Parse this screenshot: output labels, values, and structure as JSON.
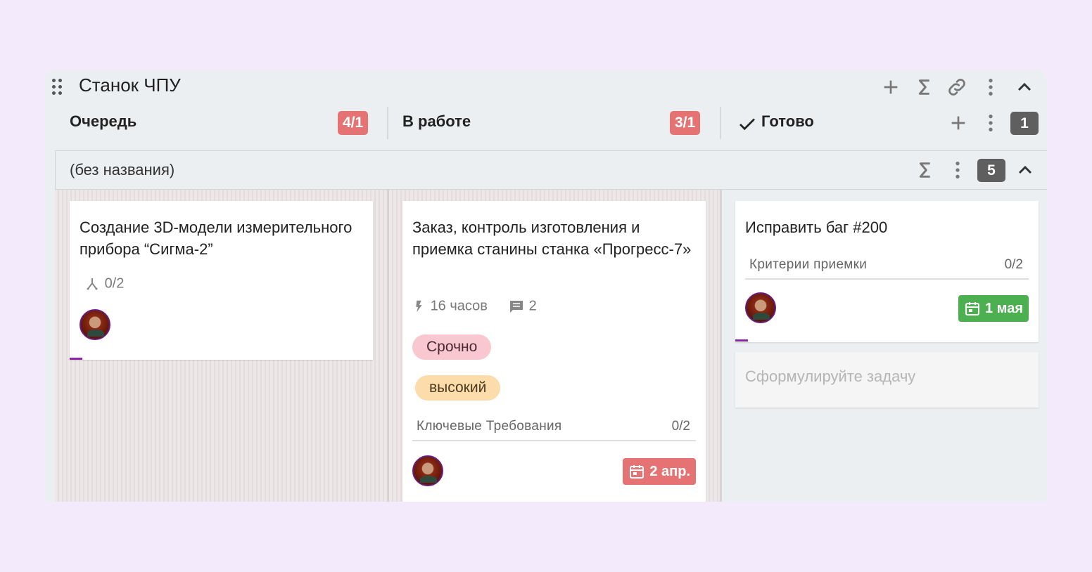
{
  "board": {
    "title": "Станок ЧПУ"
  },
  "columns": [
    {
      "label": "Очередь",
      "wip": "4/1"
    },
    {
      "label": "В работе",
      "wip": "3/1"
    },
    {
      "label": "Готово",
      "count": "1"
    }
  ],
  "swimlane": {
    "title": "(без названия)",
    "count": "5"
  },
  "cards": {
    "queue": {
      "title": "Создание 3D-модели измерительного прибора “Сигма-2”",
      "subtasks": "0/2"
    },
    "in_progress": {
      "title": "Заказ, контроль изготовления и приемка станины станка «Прогресс-7»",
      "estimate": "16 часов",
      "comments": "2",
      "tags": [
        "Срочно",
        "высокий"
      ],
      "checklist_label": "Ключевые Требования",
      "checklist_count": "0/2",
      "due": "2 апр."
    },
    "done": {
      "title": "Исправить баг #200",
      "checklist_label": "Критерии приемки",
      "checklist_count": "0/2",
      "due": "1 мая"
    }
  },
  "new_task": {
    "placeholder": "Сформулируйте задачу"
  },
  "colors": {
    "page_bg": "#f3eafc",
    "board_bg": "#eceff1",
    "wip_exceeded": "#e57373",
    "due_ok": "#4caf50",
    "due_overdue": "#e57373",
    "tag_urgent": "#f8c7cf",
    "tag_high": "#fbdcaa",
    "count_badge": "#5f5f5f"
  },
  "icons": {
    "drag": "drag-handle-icon",
    "add": "plus-icon",
    "sum": "sigma-icon",
    "link": "link-icon",
    "more": "more-vertical-icon",
    "collapse": "chevron-up-icon",
    "done_check": "check-icon",
    "subtasks": "subtasks-icon",
    "estimate": "lightning-icon",
    "comments": "comment-icon",
    "calendar": "calendar-icon"
  }
}
